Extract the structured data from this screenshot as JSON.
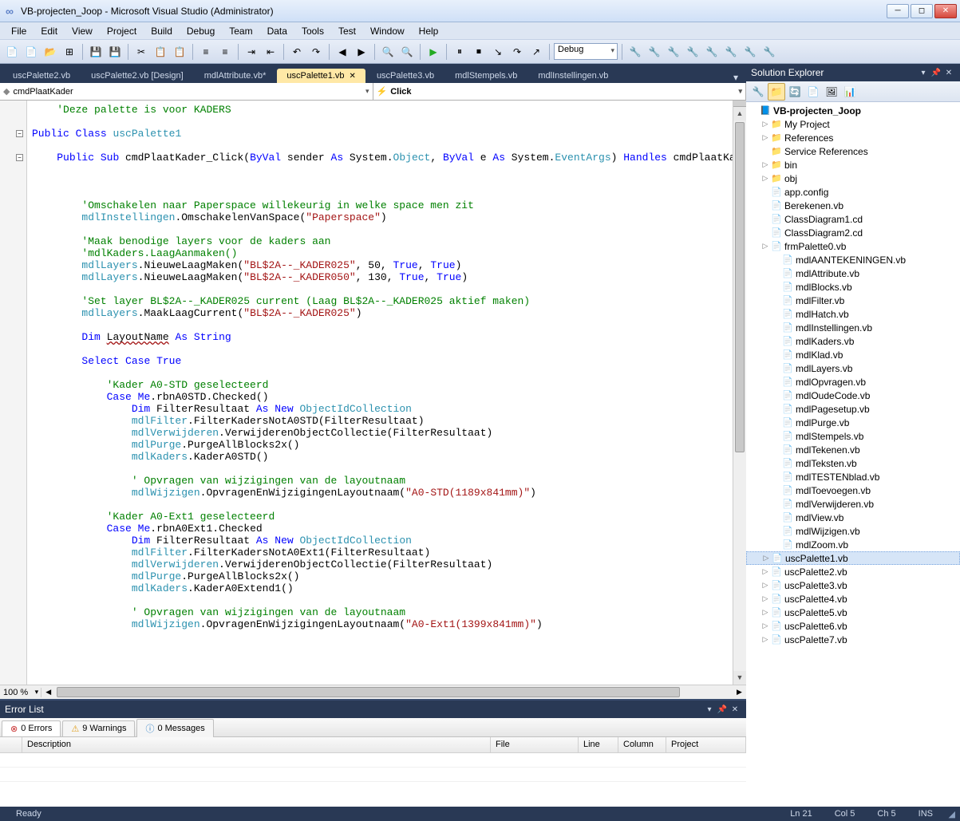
{
  "window": {
    "title": "VB-projecten_Joop - Microsoft Visual Studio (Administrator)"
  },
  "menu": [
    "File",
    "Edit",
    "View",
    "Project",
    "Build",
    "Debug",
    "Team",
    "Data",
    "Tools",
    "Test",
    "Window",
    "Help"
  ],
  "toolbar_config": "Debug",
  "doc_tabs": [
    {
      "label": "uscPalette2.vb",
      "active": false
    },
    {
      "label": "uscPalette2.vb [Design]",
      "active": false
    },
    {
      "label": "mdlAttribute.vb*",
      "active": false
    },
    {
      "label": "uscPalette1.vb",
      "active": true
    },
    {
      "label": "uscPalette3.vb",
      "active": false
    },
    {
      "label": "mdlStempels.vb",
      "active": false
    },
    {
      "label": "mdlInstellingen.vb",
      "active": false
    }
  ],
  "nav": {
    "left": "cmdPlaatKader",
    "right": "Click"
  },
  "zoom": "100 %",
  "error_list": {
    "title": "Error List",
    "tabs": {
      "errors": "0 Errors",
      "warnings": "9 Warnings",
      "messages": "0 Messages"
    },
    "cols": [
      "Description",
      "File",
      "Line",
      "Column",
      "Project"
    ]
  },
  "solution_explorer": {
    "title": "Solution Explorer",
    "root": "VB-projecten_Joop",
    "folders": [
      {
        "label": "My Project",
        "exp": "▷"
      },
      {
        "label": "References",
        "exp": "▷"
      },
      {
        "label": "Service References",
        "exp": ""
      },
      {
        "label": "bin",
        "exp": "▷"
      },
      {
        "label": "obj",
        "exp": "▷"
      }
    ],
    "files_top": [
      "app.config",
      "Berekenen.vb",
      "ClassDiagram1.cd",
      "ClassDiagram2.cd"
    ],
    "files_expandable": [
      "frmPalette0.vb"
    ],
    "files_mdl": [
      "mdlAANTEKENINGEN.vb",
      "mdlAttribute.vb",
      "mdlBlocks.vb",
      "mdlFilter.vb",
      "mdlHatch.vb",
      "mdlInstellingen.vb",
      "mdlKaders.vb",
      "mdlKlad.vb",
      "mdlLayers.vb",
      "mdlOpvragen.vb",
      "mdlOudeCode.vb",
      "mdlPagesetup.vb",
      "mdlPurge.vb",
      "mdlStempels.vb",
      "mdlTekenen.vb",
      "mdlTeksten.vb",
      "mdlTESTENblad.vb",
      "mdlToevoegen.vb",
      "mdlVerwijderen.vb",
      "mdlView.vb",
      "mdlWijzigen.vb",
      "mdlZoom.vb"
    ],
    "files_usc": [
      "uscPalette1.vb",
      "uscPalette2.vb",
      "uscPalette3.vb",
      "uscPalette4.vb",
      "uscPalette5.vb",
      "uscPalette6.vb",
      "uscPalette7.vb"
    ]
  },
  "status": {
    "ready": "Ready",
    "ln": "Ln 21",
    "col": "Col 5",
    "ch": "Ch 5",
    "ins": "INS"
  },
  "code_lines": [
    {
      "i": 0,
      "t": "    <c>'Deze palette is voor KADERS</c>"
    },
    {
      "i": 0,
      "t": ""
    },
    {
      "i": 0,
      "t": "<k>Public</k> <k>Class</k> <t>uscPalette1</t>",
      "fold": "−"
    },
    {
      "i": 0,
      "t": ""
    },
    {
      "i": 0,
      "t": "    <k>Public</k> <k>Sub</k> cmdPlaatKader_Click(<k>ByVal</k> sender <k>As</k> System.<t>Object</t>, <k>ByVal</k> e <k>As</k> System.<t>EventArgs</t>) <k>Handles</k> cmdPlaatKader.Click",
      "fold": "−"
    },
    {
      "i": 0,
      "t": ""
    },
    {
      "i": 0,
      "t": ""
    },
    {
      "i": 0,
      "t": ""
    },
    {
      "i": 2,
      "t": "<c>'Omschakelen naar Paperspace willekeurig in welke space men zit</c>"
    },
    {
      "i": 2,
      "t": "<t>mdlInstellingen</t>.OmschakelenVanSpace(<s>\"Paperspace\"</s>)"
    },
    {
      "i": 0,
      "t": ""
    },
    {
      "i": 2,
      "t": "<c>'Maak benodige layers voor de kaders aan</c>"
    },
    {
      "i": 2,
      "t": "<c>'mdlKaders.LaagAanmaken()</c>"
    },
    {
      "i": 2,
      "t": "<t>mdlLayers</t>.NieuweLaagMaken(<s>\"BL$2A--_KADER025\"</s>, 50, <k>True</k>, <k>True</k>)"
    },
    {
      "i": 2,
      "t": "<t>mdlLayers</t>.NieuweLaagMaken(<s>\"BL$2A--_KADER050\"</s>, 130, <k>True</k>, <k>True</k>)"
    },
    {
      "i": 0,
      "t": ""
    },
    {
      "i": 2,
      "t": "<c>'Set layer BL$2A--_KADER025 current (Laag BL$2A--_KADER025 aktief maken)</c>"
    },
    {
      "i": 2,
      "t": "<t>mdlLayers</t>.MaakLaagCurrent(<s>\"BL$2A--_KADER025\"</s>)"
    },
    {
      "i": 0,
      "t": ""
    },
    {
      "i": 2,
      "t": "<k>Dim</k> <squig>LayoutName</squig> <k>As</k> <k>String</k>"
    },
    {
      "i": 0,
      "t": ""
    },
    {
      "i": 2,
      "t": "<k>Select</k> <k>Case</k> <k>True</k>"
    },
    {
      "i": 0,
      "t": ""
    },
    {
      "i": 3,
      "t": "<c>'Kader A0-STD geselecteerd</c>"
    },
    {
      "i": 3,
      "t": "<k>Case</k> <k>Me</k>.rbnA0STD.Checked()"
    },
    {
      "i": 4,
      "t": "<k>Dim</k> FilterResultaat <k>As</k> <k>New</k> <t>ObjectIdCollection</t>"
    },
    {
      "i": 4,
      "t": "<t>mdlFilter</t>.FilterKadersNotA0STD(FilterResultaat)"
    },
    {
      "i": 4,
      "t": "<t>mdlVerwijderen</t>.VerwijderenObjectCollectie(FilterResultaat)"
    },
    {
      "i": 4,
      "t": "<t>mdlPurge</t>.PurgeAllBlocks2x()"
    },
    {
      "i": 4,
      "t": "<t>mdlKaders</t>.KaderA0STD()"
    },
    {
      "i": 0,
      "t": ""
    },
    {
      "i": 4,
      "t": "<c>' Opvragen van wijzigingen van de layoutnaam</c>"
    },
    {
      "i": 4,
      "t": "<t>mdlWijzigen</t>.OpvragenEnWijzigingenLayoutnaam(<s>\"A0-STD(1189x841mm)\"</s>)"
    },
    {
      "i": 0,
      "t": ""
    },
    {
      "i": 3,
      "t": "<c>'Kader A0-Ext1 geselecteerd</c>"
    },
    {
      "i": 3,
      "t": "<k>Case</k> <k>Me</k>.rbnA0Ext1.Checked"
    },
    {
      "i": 4,
      "t": "<k>Dim</k> FilterResultaat <k>As</k> <k>New</k> <t>ObjectIdCollection</t>"
    },
    {
      "i": 4,
      "t": "<t>mdlFilter</t>.FilterKadersNotA0Ext1(FilterResultaat)"
    },
    {
      "i": 4,
      "t": "<t>mdlVerwijderen</t>.VerwijderenObjectCollectie(FilterResultaat)"
    },
    {
      "i": 4,
      "t": "<t>mdlPurge</t>.PurgeAllBlocks2x()"
    },
    {
      "i": 4,
      "t": "<t>mdlKaders</t>.KaderA0Extend1()"
    },
    {
      "i": 0,
      "t": ""
    },
    {
      "i": 4,
      "t": "<c>' Opvragen van wijzigingen van de layoutnaam</c>"
    },
    {
      "i": 4,
      "t": "<t>mdlWijzigen</t>.OpvragenEnWijzigingenLayoutnaam(<s>\"A0-Ext1(1399x841mm)\"</s>)"
    }
  ]
}
